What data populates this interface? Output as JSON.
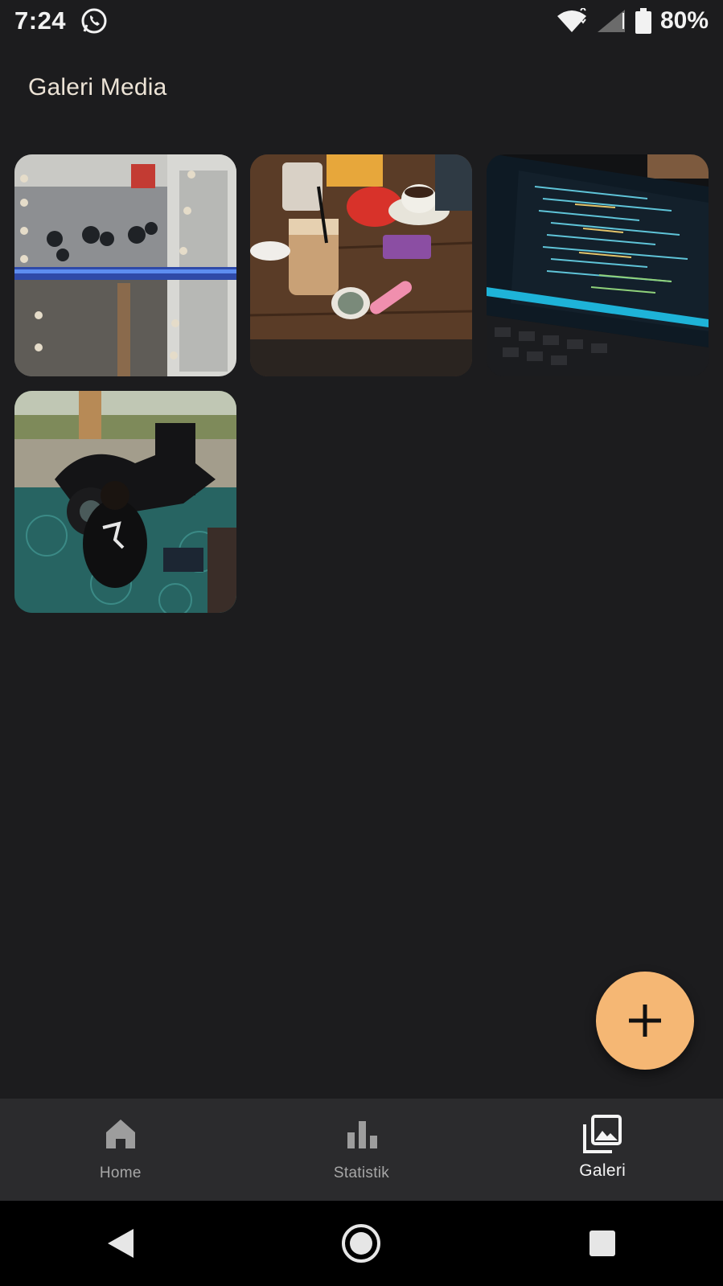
{
  "status_bar": {
    "time": "7:24",
    "battery": "80%",
    "icons": [
      "whatsapp-icon",
      "wifi-icon",
      "signal-icon",
      "battery-icon"
    ]
  },
  "header": {
    "title": "Galeri Media"
  },
  "gallery": {
    "images": [
      {
        "name": "photo-balcony-motorcycles",
        "alt": ""
      },
      {
        "name": "photo-cafe-table-drinks",
        "alt": ""
      },
      {
        "name": "photo-laptop-code-editor",
        "alt": ""
      },
      {
        "name": "photo-motorcycle-repair",
        "alt": ""
      }
    ]
  },
  "fab": {
    "icon": "plus-icon",
    "color": "#f5b774"
  },
  "bottom_nav": {
    "items": [
      {
        "label": "Home",
        "icon": "home-icon",
        "active": false
      },
      {
        "label": "Statistik",
        "icon": "bar-chart-icon",
        "active": false
      },
      {
        "label": "Galeri",
        "icon": "photo-library-icon",
        "active": true
      }
    ]
  },
  "system_nav": {
    "buttons": [
      "back-icon",
      "home-circle-icon",
      "recents-icon"
    ]
  }
}
